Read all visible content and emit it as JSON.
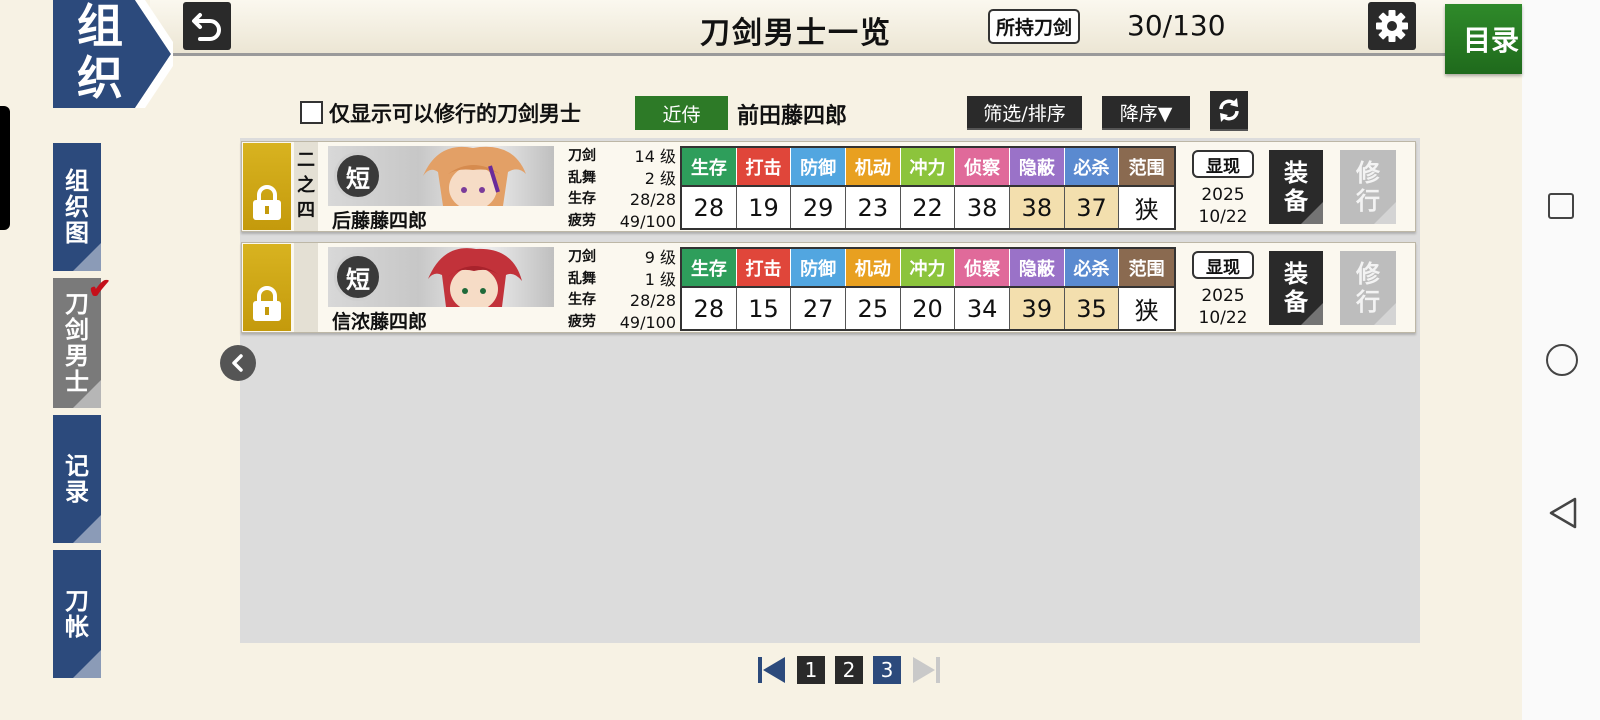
{
  "header": {
    "org_tab": [
      "组",
      "织"
    ],
    "title": "刀剑男士一览",
    "owned_label": "所持刀剑",
    "owned_count": "30/130",
    "menu_label": "目录"
  },
  "side_tabs": [
    {
      "label": [
        "组",
        "织",
        "图"
      ]
    },
    {
      "label": [
        "刀",
        "剑",
        "男",
        "士"
      ],
      "active": true
    },
    {
      "label": [
        "记",
        "录"
      ]
    },
    {
      "label": [
        "刀",
        "帐"
      ]
    }
  ],
  "filter": {
    "checkbox_label": "仅显示可以修行的刀剑男士",
    "attendant_badge": "近侍",
    "attendant_name": "前田藤四郎",
    "filter_sort_label": "筛选/排序",
    "order_label": "降序▼"
  },
  "table": {
    "stat_headers": [
      {
        "label": "生存",
        "color": "#2e9e5b"
      },
      {
        "label": "打击",
        "color": "#e0463a"
      },
      {
        "label": "防御",
        "color": "#52a6e0"
      },
      {
        "label": "机动",
        "color": "#e8a020"
      },
      {
        "label": "冲力",
        "color": "#8cc43c"
      },
      {
        "label": "侦察",
        "color": "#e06a9a"
      },
      {
        "label": "隐蔽",
        "color": "#9a72c8"
      },
      {
        "label": "必杀",
        "color": "#5a8ad0"
      },
      {
        "label": "范围",
        "color": "#8a6a50"
      }
    ],
    "stat_labels": [
      "刀剑",
      "乱舞",
      "生存",
      "疲劳"
    ],
    "show_label": "显现",
    "equip_label": [
      "装",
      "备"
    ],
    "train_label": [
      "修",
      "行"
    ],
    "rows": [
      {
        "rank": [
          "二",
          "之",
          "四"
        ],
        "type_badge": "短",
        "name": "后藤藤四郎",
        "sword_level": "14 级",
        "ranbu_level": "2 级",
        "hp": "28/28",
        "fatigue": "49/100",
        "stats": [
          "28",
          "19",
          "29",
          "23",
          "22",
          "38",
          "38",
          "37",
          "狭"
        ],
        "date_year": "2025",
        "date_md": "10/22"
      },
      {
        "rank": [
          "",
          "",
          ""
        ],
        "type_badge": "短",
        "name": "信浓藤四郎",
        "sword_level": "9 级",
        "ranbu_level": "1 级",
        "hp": "28/28",
        "fatigue": "49/100",
        "stats": [
          "28",
          "15",
          "27",
          "25",
          "20",
          "34",
          "39",
          "35",
          "狭"
        ],
        "date_year": "2025",
        "date_md": "10/22"
      }
    ]
  },
  "pagination": {
    "pages": [
      "1",
      "2",
      "3"
    ],
    "current": "3"
  }
}
